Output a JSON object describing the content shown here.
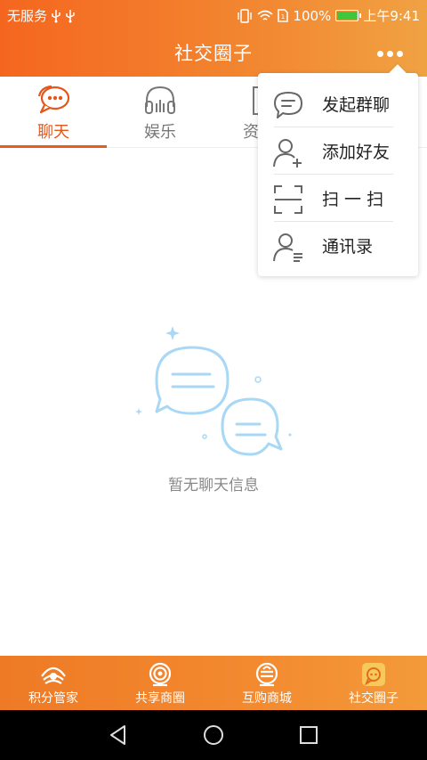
{
  "status": {
    "carrier": "无服务",
    "usb_icons": [
      "usb-icon",
      "usb-icon"
    ],
    "right_icons": [
      "vibrate-icon",
      "wifi-icon",
      "sim-icon"
    ],
    "battery_percent": "100%",
    "time": "上午9:41"
  },
  "header": {
    "title": "社交圈子"
  },
  "tabs": [
    {
      "label": "聊天",
      "icon": "chat-bubble-icon",
      "active": true
    },
    {
      "label": "娱乐",
      "icon": "headphones-icon",
      "active": false
    },
    {
      "label": "资",
      "icon": "document-icon",
      "active": false
    }
  ],
  "popup_menu": {
    "items": [
      {
        "label": "发起群聊",
        "icon": "group-chat-icon"
      },
      {
        "label": "添加好友",
        "icon": "add-friend-icon"
      },
      {
        "label": "扫 一 扫",
        "icon": "scan-icon"
      },
      {
        "label": "通讯录",
        "icon": "contacts-icon"
      }
    ]
  },
  "empty_state": {
    "message": "暂无聊天信息",
    "icon": "empty-chat-illustration"
  },
  "bottom_nav": [
    {
      "label": "积分管家",
      "icon": "points-manager-icon"
    },
    {
      "label": "共享商圈",
      "icon": "shared-business-icon"
    },
    {
      "label": "互购商城",
      "icon": "mall-icon"
    },
    {
      "label": "社交圈子",
      "icon": "social-circle-icon"
    }
  ],
  "colors": {
    "brand_orange": "#f4661f",
    "active_tab": "#e4571a",
    "illustration_blue": "#a8d8f5"
  }
}
